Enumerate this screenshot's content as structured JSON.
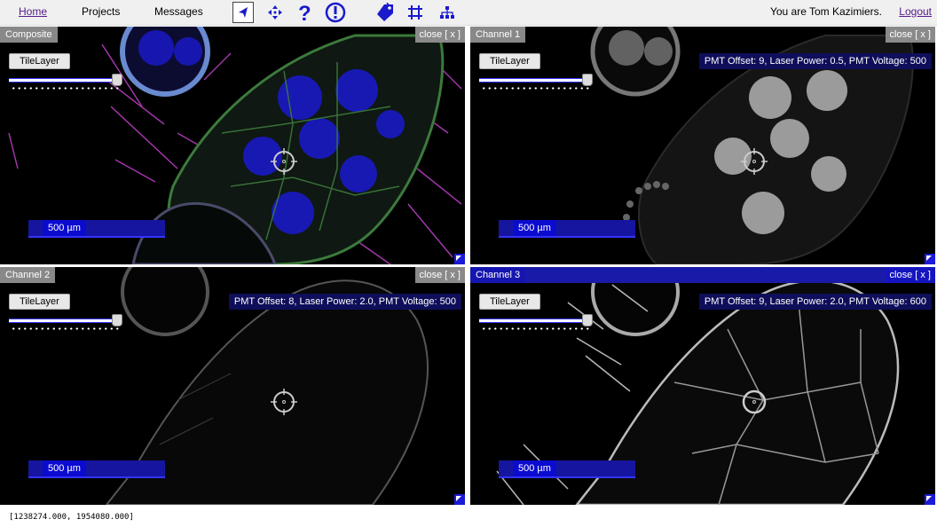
{
  "nav": {
    "home": "Home",
    "projects": "Projects",
    "messages": "Messages",
    "user_text": "You are Tom Kazimiers.",
    "logout": "Logout"
  },
  "toolbar": {
    "tools": [
      "navigate-tool",
      "move-tool",
      "help-tool",
      "alert-tool",
      "tag-tool",
      "crop-tool",
      "tree-tool"
    ],
    "active_tool": "navigate-tool"
  },
  "panels": {
    "composite": {
      "title": "Composite",
      "close": "close [ x ]",
      "tilelayer": "TileLayer",
      "scale": "500 µm",
      "info": ""
    },
    "channel1": {
      "title": "Channel 1",
      "close": "close [ x ]",
      "tilelayer": "TileLayer",
      "scale": "500 µm",
      "info": "PMT Offset: 9, Laser Power: 0.5, PMT Voltage: 500"
    },
    "channel2": {
      "title": "Channel 2",
      "close": "close [ x ]",
      "tilelayer": "TileLayer",
      "scale": "500 µm",
      "info": "PMT Offset: 8, Laser Power: 2.0, PMT Voltage: 500"
    },
    "channel3": {
      "title": "Channel 3",
      "close": "close [ x ]",
      "tilelayer": "TileLayer",
      "scale": "500 µm",
      "info": "PMT Offset: 9, Laser Power: 2.0, PMT Voltage: 600"
    }
  },
  "status": {
    "coords": "[1238274.000, 1954080.000]"
  },
  "colors": {
    "title_gray": "#888888",
    "accent_blue": "#1515b0",
    "nuclei_blue": "#1a1ad0",
    "membrane_green": "#3c7a3c",
    "magenta": "#c040c8"
  }
}
